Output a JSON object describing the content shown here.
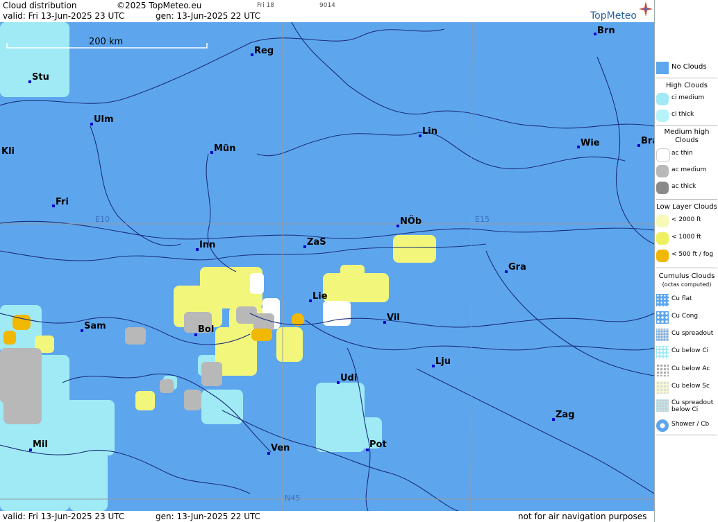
{
  "header": {
    "product": "Cloud distribution",
    "copyright": "©2025 TopMeteo.eu",
    "day_tag": "Fri 18",
    "code": "9014",
    "valid": "valid:  Fri  13-Jun-2025  23 UTC",
    "gen": "gen: 13-Jun-2025 22 UTC",
    "logo": "TopMeteo"
  },
  "footer": {
    "valid": "valid:  Fri  13-Jun-2025  23 UTC",
    "gen": "gen: 13-Jun-2025 22 UTC",
    "disclaimer": "not for air navigation purposes"
  },
  "map": {
    "scale_label": "200 km",
    "grid_labels": {
      "e10": "E10",
      "e15": "E15",
      "n45": "N45"
    },
    "cities": [
      "Brn",
      "Reg",
      "Stu",
      "Ulm",
      "Lin",
      "Wie",
      "Bra",
      "Kli",
      "Mün",
      "Fri",
      "NÖb",
      "Inn",
      "ZaS",
      "Gra",
      "Lie",
      "Vil",
      "Sam",
      "Bol",
      "Lju",
      "Udi",
      "Zag",
      "Mil",
      "Ven",
      "Pot"
    ],
    "colors": {
      "no_clouds": "#5da6ee",
      "ci": "#9feaf5",
      "ac_thin": "#ffffff",
      "ac_medium": "#b8b8b8",
      "low": "#f2f77c",
      "fog": "#f0b800",
      "water_lines": "#1a2e7a",
      "grid": "#9a9aa0"
    }
  },
  "legend": {
    "no_clouds": "No Clouds",
    "high_title": "High Clouds",
    "ci_medium": "ci medium",
    "ci_thick": "ci thick",
    "mid_title": "Medium high Clouds",
    "ac_thin": "ac thin",
    "ac_medium": "ac medium",
    "ac_thick": "ac thick",
    "low_title": "Low Layer Clouds",
    "low_2000": "< 2000 ft",
    "low_1000": "< 1000 ft",
    "low_500": "< 500 ft / fog",
    "cu_title": "Cumulus Clouds",
    "cu_sub": "(octas computed)",
    "cu_flat": "Cu flat",
    "cu_cong": "Cu Cong",
    "cu_spread": "Cu spreadout",
    "cu_below_ci": "Cu below Ci",
    "cu_below_ac": "Cu below Ac",
    "cu_below_sc": "Cu below Sc",
    "cu_spread_ci": "Cu spreadout below Ci",
    "shower": "Shower / Cb"
  }
}
